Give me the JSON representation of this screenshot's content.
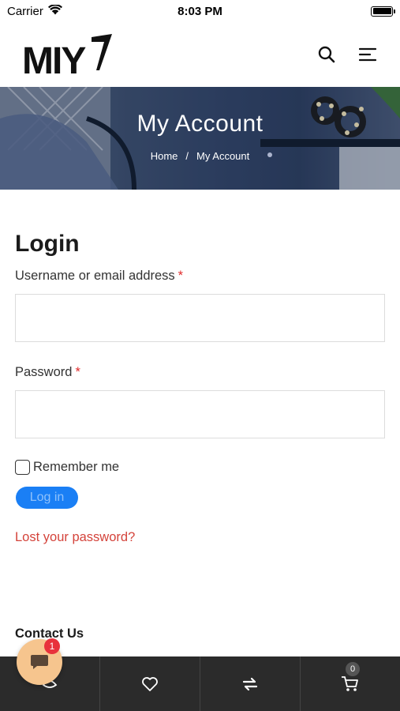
{
  "status": {
    "carrier": "Carrier",
    "time": "8:03 PM"
  },
  "header": {
    "logo_text": "MIY"
  },
  "banner": {
    "title": "My Account",
    "breadcrumb": [
      "Home",
      "/",
      "My Account"
    ]
  },
  "login": {
    "title": "Login",
    "username_label": "Username or email address",
    "password_label": "Password",
    "required_mark": "*",
    "username_value": "",
    "password_value": "",
    "remember_label": "Remember me",
    "login_button": "Log in",
    "lost_password": "Lost your password?"
  },
  "footer": {
    "contact_title": "Contact Us"
  },
  "chat": {
    "badge_count": "1"
  },
  "bottom_nav": {
    "cart_count": "0"
  },
  "colors": {
    "accent": "#1a7ff5",
    "link": "#d4433b",
    "required": "#e02b2b",
    "nav_bg": "#2b2b2b"
  }
}
